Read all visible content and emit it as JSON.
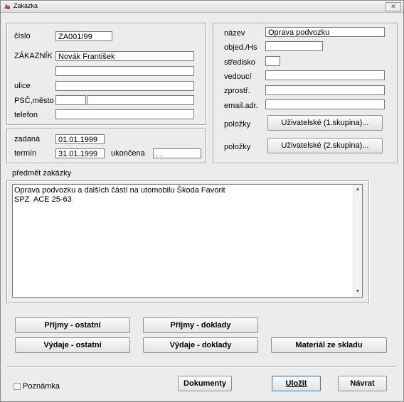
{
  "window": {
    "title": "Zakázka",
    "close": "✕"
  },
  "left": {
    "cislo_label": "číslo",
    "cislo": "ZA001/99",
    "zakaznik_label": "ZÁKAZNÍK",
    "zakaznik": "Novák František",
    "zakaznik2": "",
    "ulice_label": "ulice",
    "ulice": "",
    "psc_label": "PSČ,město",
    "psc": "",
    "mesto": "",
    "telefon_label": "telefon",
    "telefon": ""
  },
  "dates": {
    "zadana_label": "zadaná",
    "zadana": "01.01.1999",
    "termin_label": "termín",
    "termin": "31.01.1999",
    "ukoncena_label": "ukončena",
    "ukoncena": ". ."
  },
  "right": {
    "nazev_label": "název",
    "nazev": "Oprava podvozku",
    "objed_label": "objed./Hs",
    "objed": "",
    "stredisko_label": "středisko",
    "stredisko": "",
    "vedouci_label": "vedoucí",
    "vedouci": "",
    "zprostr_label": "zprostř.",
    "zprostr": "",
    "email_label": "email.adr.",
    "email": "",
    "polozky1_label": "položky",
    "polozky1_button": "Uživatelské (1.skupina)...",
    "polozky2_label": "položky",
    "polozky2_button": "Uživatelské (2.skupina)..."
  },
  "predmet": {
    "label": "předmět zakázky",
    "text": "Oprava podvozku a dalších částí na utomobilu Škoda Favorit\nSPZ  ACE 25-63"
  },
  "buttons": {
    "prijmy_ostatni": "Příjmy - ostatní",
    "prijmy_doklady": "Příjmy - doklady",
    "vydaje_ostatni": "Výdaje - ostatní",
    "vydaje_doklady": "Výdaje - doklady",
    "material": "Materiál ze skladu"
  },
  "footer": {
    "poznamka": "Poznámka",
    "dokumenty": "Dokumenty",
    "ulozit": "Uložit",
    "navrat": "Návrat"
  }
}
